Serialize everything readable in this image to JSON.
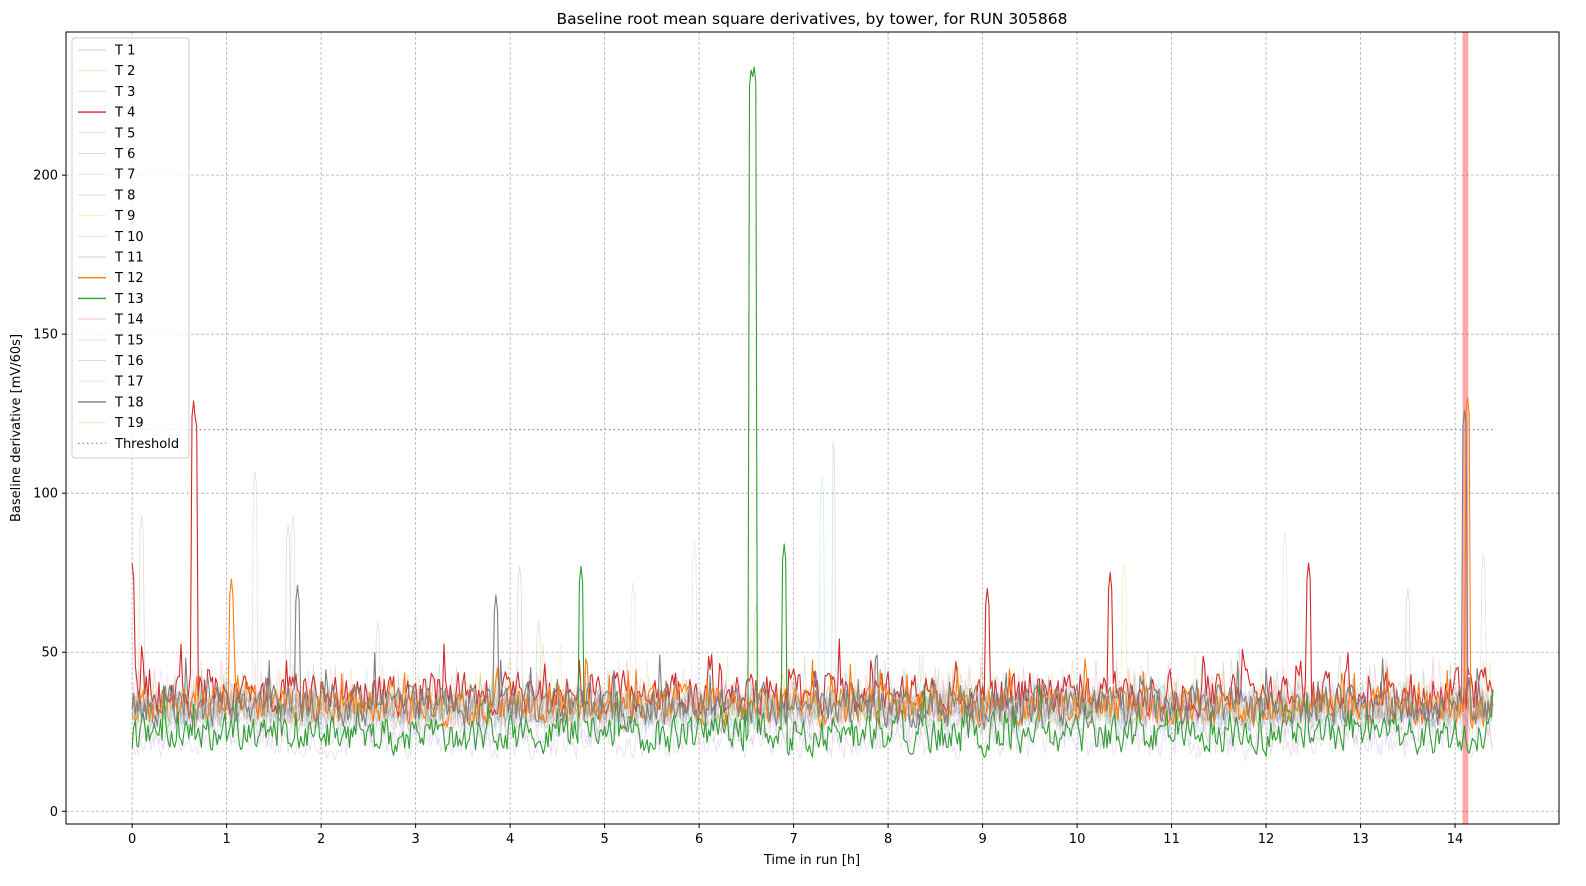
{
  "chart_data": {
    "type": "line",
    "title": "Baseline root mean square derivatives, by tower, for RUN 305868",
    "xlabel": "Time in run [h]",
    "ylabel": "Baseline derivative [mV/60s]",
    "xlim": [
      -0.7,
      15.1
    ],
    "ylim": [
      -4,
      245
    ],
    "xticks": [
      "0",
      "1",
      "2",
      "3",
      "4",
      "5",
      "6",
      "7",
      "8",
      "9",
      "10",
      "11",
      "12",
      "13",
      "14"
    ],
    "yticks": [
      "0",
      "50",
      "100",
      "150",
      "200"
    ],
    "grid": true,
    "legend_position": "upper-left",
    "threshold": 120,
    "highlight_span": [
      14.08,
      14.14
    ],
    "series": [
      {
        "name": "T 1",
        "color": "#1f77b4",
        "alpha": 0.22,
        "lw": 0.8,
        "base": 32,
        "amp": 8,
        "spikes": [
          [
            13.5,
            70
          ]
        ]
      },
      {
        "name": "T 2",
        "color": "#ff7f0e",
        "alpha": 0.22,
        "lw": 0.8,
        "base": 34,
        "amp": 8,
        "spikes": [
          [
            6.6,
            65
          ]
        ]
      },
      {
        "name": "T 3",
        "color": "#2ca02c",
        "alpha": 0.22,
        "lw": 0.8,
        "base": 31,
        "amp": 8,
        "spikes": [
          [
            4.3,
            60
          ]
        ]
      },
      {
        "name": "T 4",
        "color": "#d62728",
        "alpha": 1.0,
        "lw": 1.1,
        "base": 37,
        "amp": 9,
        "spikes": [
          [
            0.0,
            78
          ],
          [
            0.65,
            129
          ],
          [
            0.67,
            125
          ],
          [
            10.35,
            75
          ],
          [
            12.45,
            78
          ],
          [
            9.05,
            70
          ]
        ]
      },
      {
        "name": "T 5",
        "color": "#9467bd",
        "alpha": 0.22,
        "lw": 0.8,
        "base": 26,
        "amp": 8,
        "spikes": [
          [
            1.3,
            107
          ],
          [
            1.7,
            93
          ]
        ]
      },
      {
        "name": "T 6",
        "color": "#8c564b",
        "alpha": 0.22,
        "lw": 0.8,
        "base": 33,
        "amp": 8,
        "spikes": [
          [
            0.1,
            93
          ]
        ]
      },
      {
        "name": "T 7",
        "color": "#e377c2",
        "alpha": 0.22,
        "lw": 0.8,
        "base": 33,
        "amp": 8,
        "spikes": [
          [
            5.95,
            85
          ],
          [
            12.2,
            88
          ]
        ]
      },
      {
        "name": "T 8",
        "color": "#7f7f7f",
        "alpha": 0.22,
        "lw": 0.8,
        "base": 32,
        "amp": 8,
        "spikes": [
          [
            14.3,
            81
          ]
        ]
      },
      {
        "name": "T 9",
        "color": "#bcbd22",
        "alpha": 0.22,
        "lw": 0.8,
        "base": 33,
        "amp": 8,
        "spikes": [
          [
            3.0,
            62
          ]
        ]
      },
      {
        "name": "T 10",
        "color": "#17becf",
        "alpha": 0.22,
        "lw": 0.8,
        "base": 32,
        "amp": 8,
        "spikes": [
          [
            7.3,
            105
          ]
        ]
      },
      {
        "name": "T 11",
        "color": "#1f77b4",
        "alpha": 0.22,
        "lw": 0.8,
        "base": 30,
        "amp": 8,
        "spikes": [
          [
            7.42,
            117
          ]
        ]
      },
      {
        "name": "T 12",
        "color": "#ff7f0e",
        "alpha": 1.0,
        "lw": 1.1,
        "base": 33,
        "amp": 8,
        "spikes": [
          [
            1.05,
            73
          ],
          [
            14.13,
            131
          ]
        ]
      },
      {
        "name": "T 13",
        "color": "#2ca02c",
        "alpha": 1.0,
        "lw": 1.1,
        "base": 24,
        "amp": 8,
        "spikes": [
          [
            6.55,
            233
          ],
          [
            6.58,
            235
          ],
          [
            6.9,
            84
          ],
          [
            4.75,
            77
          ]
        ]
      },
      {
        "name": "T 14",
        "color": "#d62728",
        "alpha": 0.22,
        "lw": 0.8,
        "base": 32,
        "amp": 8,
        "spikes": [
          [
            4.1,
            77
          ]
        ]
      },
      {
        "name": "T 15",
        "color": "#9467bd",
        "alpha": 0.22,
        "lw": 0.8,
        "base": 22,
        "amp": 7,
        "spikes": [
          [
            2.6,
            60
          ]
        ]
      },
      {
        "name": "T 16",
        "color": "#8c564b",
        "alpha": 0.22,
        "lw": 0.8,
        "base": 31,
        "amp": 8,
        "spikes": [
          [
            1.65,
            90
          ]
        ]
      },
      {
        "name": "T 17",
        "color": "#e377c2",
        "alpha": 0.22,
        "lw": 0.8,
        "base": 33,
        "amp": 8,
        "spikes": [
          [
            5.3,
            72
          ]
        ]
      },
      {
        "name": "T 18",
        "color": "#7f7f7f",
        "alpha": 1.0,
        "lw": 1.1,
        "base": 33,
        "amp": 9,
        "spikes": [
          [
            1.75,
            71
          ],
          [
            3.85,
            68
          ],
          [
            14.1,
            126
          ]
        ]
      },
      {
        "name": "T 19",
        "color": "#bcbd22",
        "alpha": 0.22,
        "lw": 0.8,
        "base": 33,
        "amp": 8,
        "spikes": [
          [
            10.5,
            78
          ]
        ]
      }
    ],
    "threshold_label": "Threshold"
  }
}
